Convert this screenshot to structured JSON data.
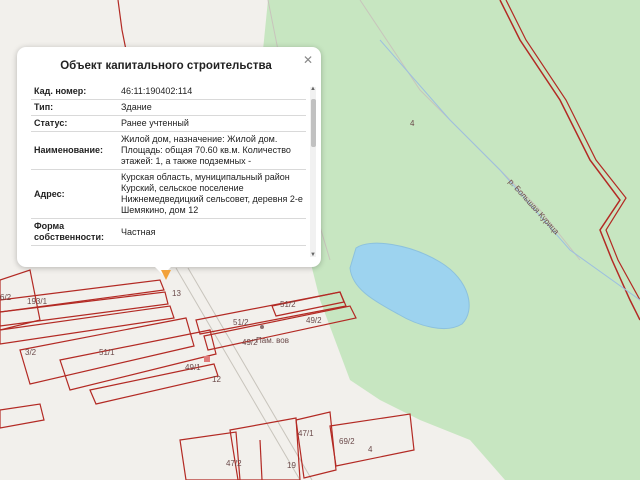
{
  "popup": {
    "title": "Объект капитального строительства",
    "rows": [
      {
        "key": "Кад. номер:",
        "value": "46:11:190402:114"
      },
      {
        "key": "Тип:",
        "value": "Здание"
      },
      {
        "key": "Статус:",
        "value": "Ранее учтенный"
      },
      {
        "key": "Наименование:",
        "value": "Жилой дом, назначение: Жилой дом. Площадь: общая 70.60 кв.м. Количество этажей: 1, а также подземных -"
      },
      {
        "key": "Адрес:",
        "value": "Курская область, муниципальный район Курский, сельское поселение Нижнемедведицкий сельсовет, деревня 2-е Шемякино, дом 12"
      },
      {
        "key": "Форма собственности:",
        "value": "Частная"
      }
    ],
    "close_icon": "close-icon"
  },
  "map": {
    "colors": {
      "forest": "#c7e6c1",
      "water": "#9dd3ef",
      "parcel_line": "#b32a24",
      "background": "#f2f0ec"
    },
    "labels": {
      "forest_id": "4",
      "river": "р. Большая Курица",
      "l193_1": "193/1",
      "l6_2": "6/2",
      "l3_2": "3/2",
      "l51_1": "51/1",
      "l49_1": "49/1",
      "l51_2a": "51/2",
      "l51_2b": "51/2",
      "l49_2a": "49/2",
      "l49_2b": "49/2",
      "l47_1": "47/1",
      "l69_2": "69/2",
      "l47_2": "47/2",
      "l4": "4",
      "l13": "13",
      "l12": "12",
      "l19": "19",
      "monument": "Пам. вов"
    }
  }
}
